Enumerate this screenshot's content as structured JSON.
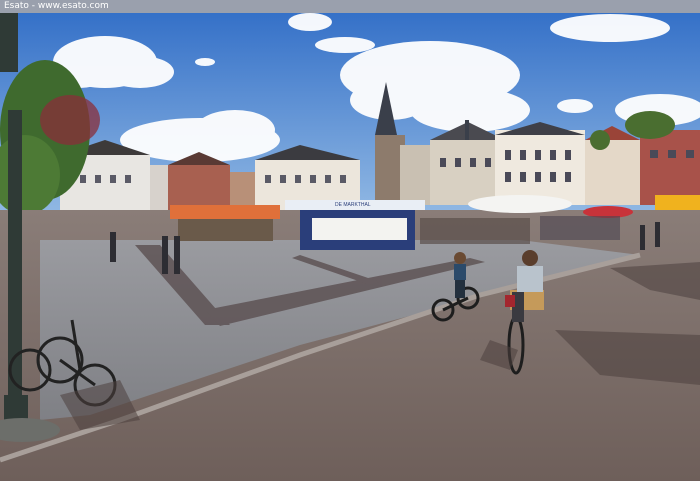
{
  "watermark": {
    "text": "Esato - www.esato.com"
  },
  "photo": {
    "subject": "town-square-with-cyclists",
    "stall_sign": "DE MARKTHAL"
  },
  "colors": {
    "sky": "#3f7fd0",
    "pavement": "#7d706b",
    "square_tiles": "#8e8f94",
    "awning_orange": "#e0703a",
    "umbrella_red": "#c8333a",
    "awning_yellow": "#f0b21e"
  }
}
